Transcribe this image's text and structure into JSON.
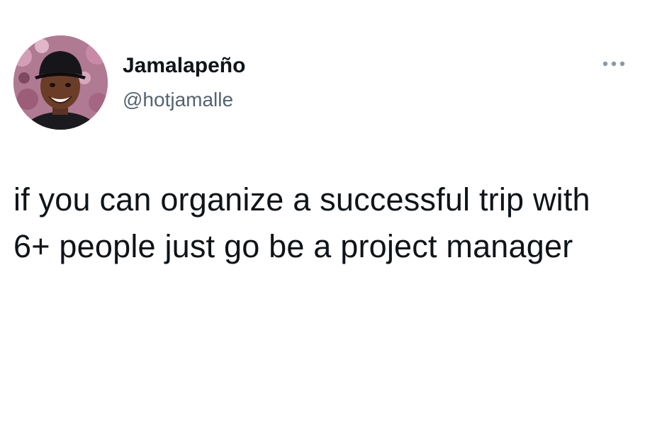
{
  "author": {
    "display_name": "Jamalapeño",
    "handle": "@hotjamalle"
  },
  "tweet": {
    "text": "if you can organize a successful trip with 6+ people just go be a project manager"
  },
  "icons": {
    "more": "more-options-icon"
  },
  "colors": {
    "text_primary": "#0f1419",
    "text_secondary": "#536471",
    "more_icon": "#8899a6",
    "background": "#ffffff"
  }
}
